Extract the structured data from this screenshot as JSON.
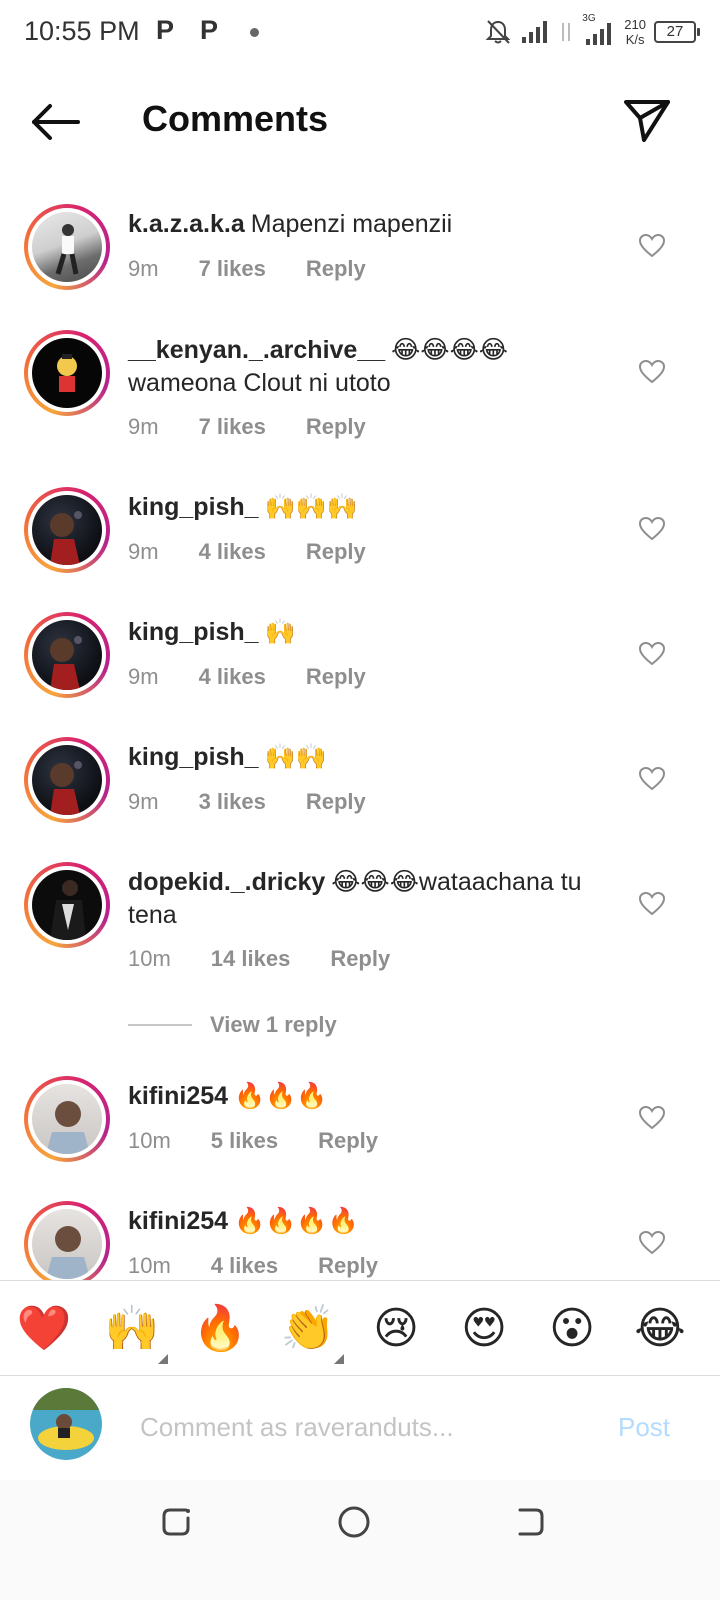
{
  "status": {
    "time": "10:55 PM",
    "app_icon_1": "P",
    "app_icon_2": "P",
    "network_type": "3G",
    "speed_value": "210",
    "speed_unit": "K/s",
    "battery": "27"
  },
  "header": {
    "title": "Comments",
    "back_icon": "arrow-left-icon",
    "share_icon": "paper-plane-icon"
  },
  "comments": [
    {
      "user": "k.a.z.a.k.a",
      "text": "Mapenzi mapenzii",
      "time": "9m",
      "likes": "7 likes",
      "reply": "Reply"
    },
    {
      "user": "__kenyan._.archive__",
      "text": "😂😂😂😂 wameona Clout ni utoto",
      "time": "9m",
      "likes": "7 likes",
      "reply": "Reply"
    },
    {
      "user": "king_pish_",
      "text": "🙌🙌🙌",
      "time": "9m",
      "likes": "4 likes",
      "reply": "Reply"
    },
    {
      "user": "king_pish_",
      "text": "🙌",
      "time": "9m",
      "likes": "4 likes",
      "reply": "Reply"
    },
    {
      "user": "king_pish_",
      "text": "🙌🙌",
      "time": "9m",
      "likes": "3 likes",
      "reply": "Reply"
    },
    {
      "user": "dopekid._.dricky",
      "text": "😂😂😂wataachana tu tena",
      "time": "10m",
      "likes": "14 likes",
      "reply": "Reply"
    },
    {
      "user": "kifini254",
      "text": "🔥🔥🔥",
      "time": "10m",
      "likes": "5 likes",
      "reply": "Reply"
    },
    {
      "user": "kifini254",
      "text": "🔥🔥🔥🔥",
      "time": "10m",
      "likes": "4 likes",
      "reply": "Reply"
    }
  ],
  "view_replies": "View 1 reply",
  "emoji_bar": [
    "❤️",
    "🙌",
    "🔥",
    "👏",
    "😢",
    "😍",
    "😮",
    "😂"
  ],
  "composer": {
    "placeholder": "Comment as raveranduts...",
    "post_label": "Post"
  },
  "colors": {
    "accent_disabled": "#b3dbff",
    "meta_gray": "#8e8e8e",
    "text": "#262626"
  }
}
